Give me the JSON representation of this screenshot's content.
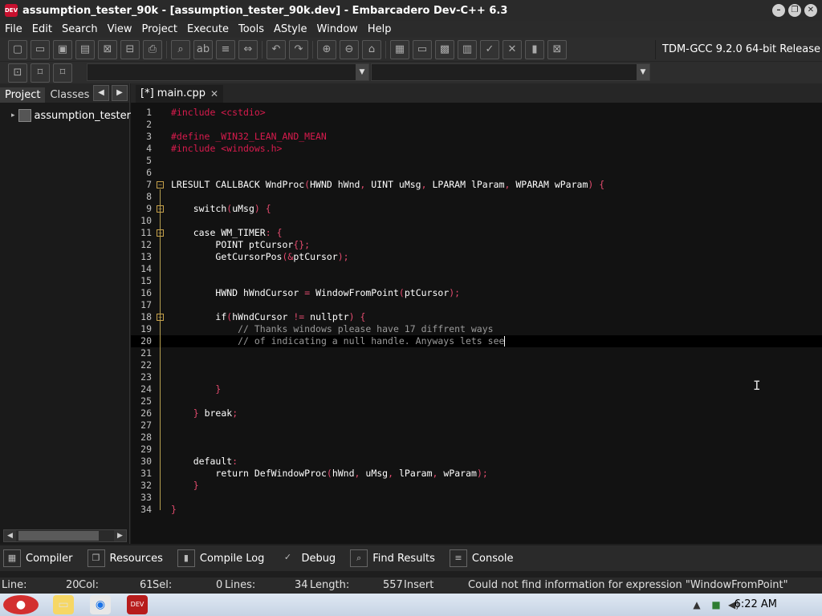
{
  "window": {
    "title": "assumption_tester_90k - [assumption_tester_90k.dev] - Embarcadero Dev-C++ 6.3",
    "app_icon_text": "DEV"
  },
  "menu": [
    "File",
    "Edit",
    "Search",
    "View",
    "Project",
    "Execute",
    "Tools",
    "AStyle",
    "Window",
    "Help"
  ],
  "toolbar": {
    "compiler": "TDM-GCC 9.2.0 64-bit Release"
  },
  "left_panel": {
    "tabs": [
      "Project",
      "Classes"
    ],
    "tree_root": "assumption_tester"
  },
  "editor": {
    "tab_label": "[*] main.cpp",
    "current_line": 20
  },
  "bottom_tabs": [
    "Compiler",
    "Resources",
    "Compile Log",
    "Debug",
    "Find Results",
    "Console"
  ],
  "status": {
    "line_label": "Line:",
    "line_value": "20",
    "col_label": "Col:",
    "col_value": "61",
    "sel_label": "Sel:",
    "sel_value": "0",
    "lines_label": "Lines:",
    "lines_value": "34",
    "length_label": "Length:",
    "length_value": "557",
    "mode": "Insert",
    "message": "Could not find information for expression \"WindowFromPoint\""
  },
  "taskbar": {
    "time": "6:22 AM"
  },
  "colors": {
    "preprocessor": "#d81b4d",
    "keyword": "#ffffff",
    "comment": "#9a9a9a",
    "punctuation": "#e34b6e",
    "background": "#121212"
  }
}
